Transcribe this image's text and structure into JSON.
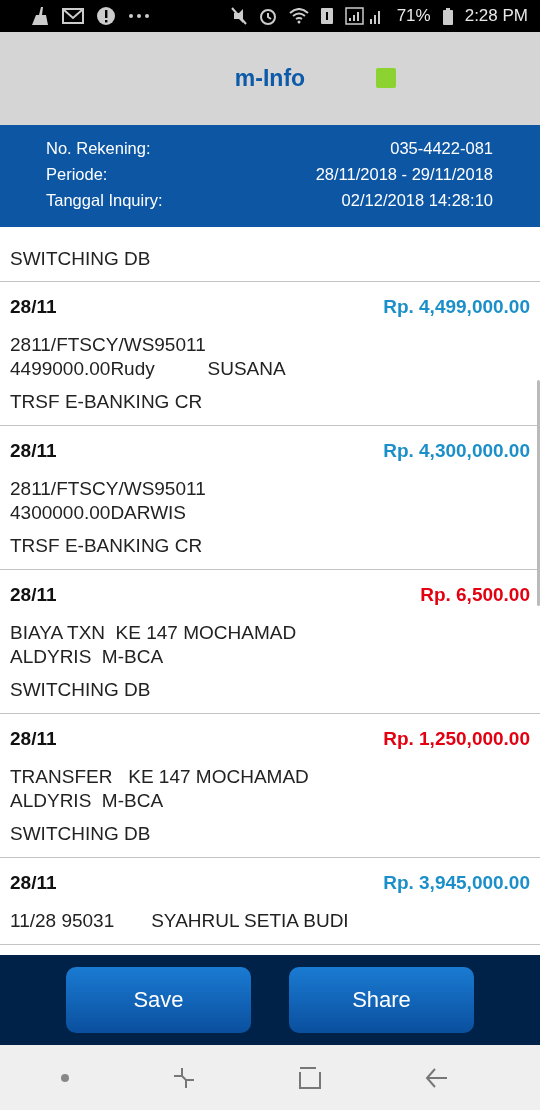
{
  "status_bar": {
    "battery": "71%",
    "time": "2:28 PM"
  },
  "header": {
    "title": "m-Info"
  },
  "info": [
    {
      "label": "No. Rekening:",
      "value": "035-4422-081"
    },
    {
      "label": "Periode:",
      "value": "28/11/2018 - 29/11/2018"
    },
    {
      "label": "Tanggal Inquiry:",
      "value": "02/12/2018 14:28:10"
    }
  ],
  "partial_entry": {
    "type": "SWITCHING DB"
  },
  "transactions": [
    {
      "date": "28/11",
      "amount": "Rp. 4,499,000.00",
      "kind": "credit",
      "description": [
        "2811/FTSCY/WS95011",
        "4499000.00Rudy          SUSANA"
      ],
      "type": "TRSF E-BANKING CR"
    },
    {
      "date": "28/11",
      "amount": "Rp. 4,300,000.00",
      "kind": "credit",
      "description": [
        "2811/FTSCY/WS95011",
        "4300000.00DARWIS"
      ],
      "type": "TRSF E-BANKING CR"
    },
    {
      "date": "28/11",
      "amount": "Rp. 6,500.00",
      "kind": "debit",
      "description": [
        "BIAYA TXN  KE 147 MOCHAMAD",
        "ALDYRIS  M-BCA"
      ],
      "type": "SWITCHING DB"
    },
    {
      "date": "28/11",
      "amount": "Rp. 1,250,000.00",
      "kind": "debit",
      "description": [
        "TRANSFER   KE 147 MOCHAMAD",
        "ALDYRIS  M-BCA"
      ],
      "type": "SWITCHING DB"
    },
    {
      "date": "28/11",
      "amount": "Rp. 3,945,000.00",
      "kind": "credit",
      "description": [
        "11/28 95031       SYAHRUL SETIA BUDI"
      ]
    }
  ],
  "buttons": [
    "Save",
    "Share"
  ]
}
